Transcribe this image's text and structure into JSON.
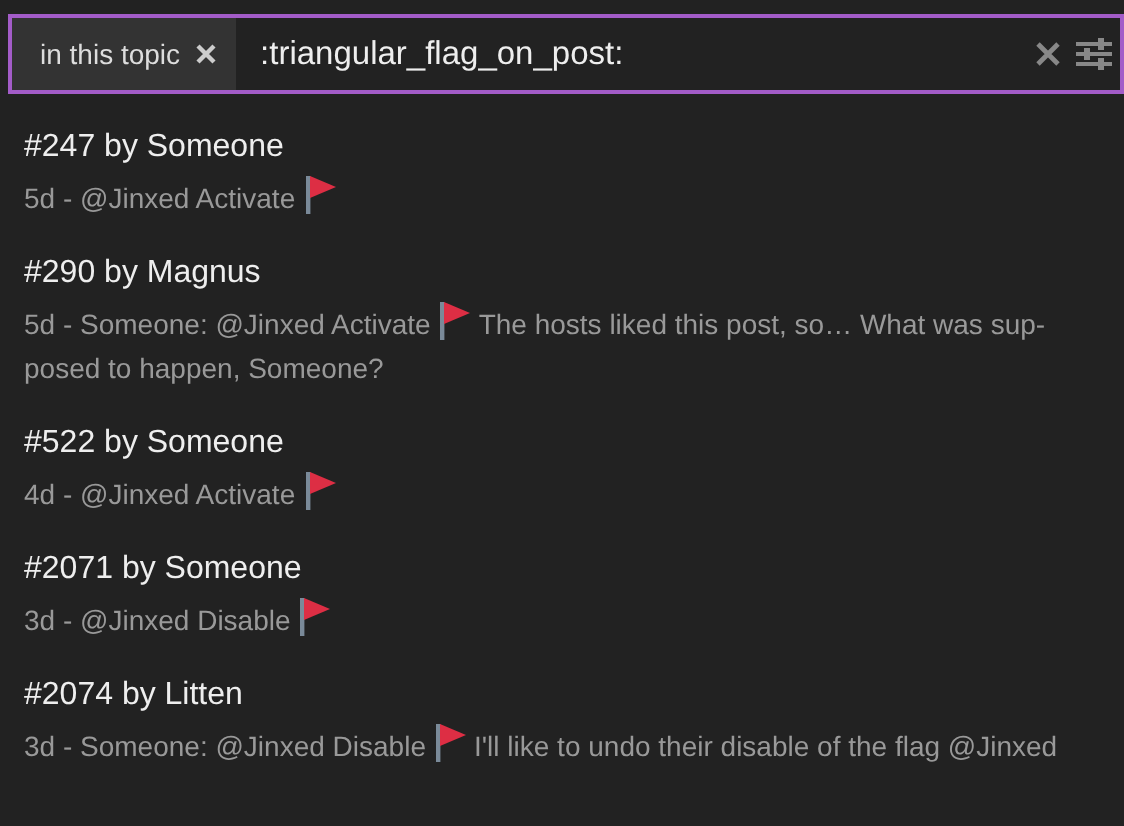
{
  "search": {
    "scope": "in this topic",
    "query": ":triangular_flag_on_post:"
  },
  "results": [
    {
      "title": "#247 by Someone",
      "before": "5d - @Jinxed Activate"
    },
    {
      "title": "#290 by Magnus",
      "before": "5d - Someone: @Jinxed Activate",
      "after": "The hosts liked this post, so… What was sup-posed to happen, Someone?"
    },
    {
      "title": "#522 by Someone",
      "before": "4d - @Jinxed Activate"
    },
    {
      "title": "#2071 by Someone",
      "before": "3d - @Jinxed Disable"
    },
    {
      "title": "#2074 by Litten",
      "before": "3d - Someone: @Jinxed Disable",
      "after": "I'll like to undo their disable of the flag @Jinxed"
    }
  ]
}
